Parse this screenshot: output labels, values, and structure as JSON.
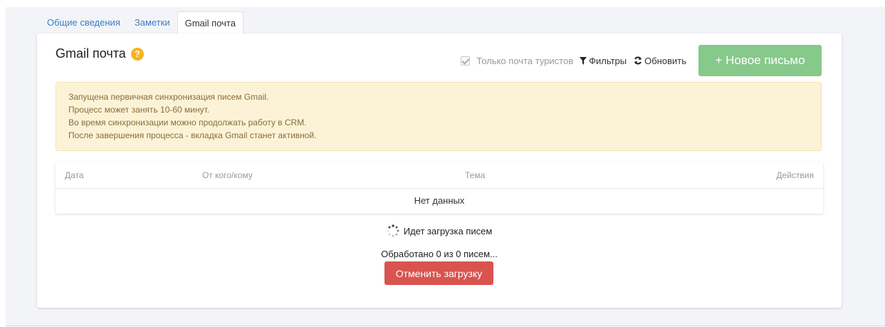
{
  "tabs": [
    {
      "label": "Общие сведения",
      "active": false
    },
    {
      "label": "Заметки",
      "active": false
    },
    {
      "label": "Gmail почта",
      "active": true
    }
  ],
  "panel": {
    "title": "Gmail почта",
    "help_icon": "question-circle-icon"
  },
  "toolbar": {
    "only_tourists_label": "Только почта туристов",
    "only_tourists_checked": true,
    "filters_label": "Фильтры",
    "refresh_label": "Обновить",
    "new_letter_label": "+ Новое письмо",
    "new_letter_color": "#86c98a"
  },
  "alert": {
    "lines": [
      "Запущена первичная синхронизация писем Gmail.",
      "Процесс может занять 10-60 минут.",
      "Во время синхронизации можно продолжать работу в CRM.",
      "После завершения процесса - вкладка Gmail станет активной."
    ],
    "bg_color": "#fcf3d7"
  },
  "table": {
    "columns": [
      "Дата",
      "От кого/кому",
      "Тема",
      "Действия"
    ],
    "empty_text": "Нет данных"
  },
  "loading": {
    "text": "Идет загрузка писем",
    "processed_text": "Обработано 0 из 0 писем...",
    "cancel_label": "Отменить загрузку",
    "cancel_color": "#d9534f"
  }
}
